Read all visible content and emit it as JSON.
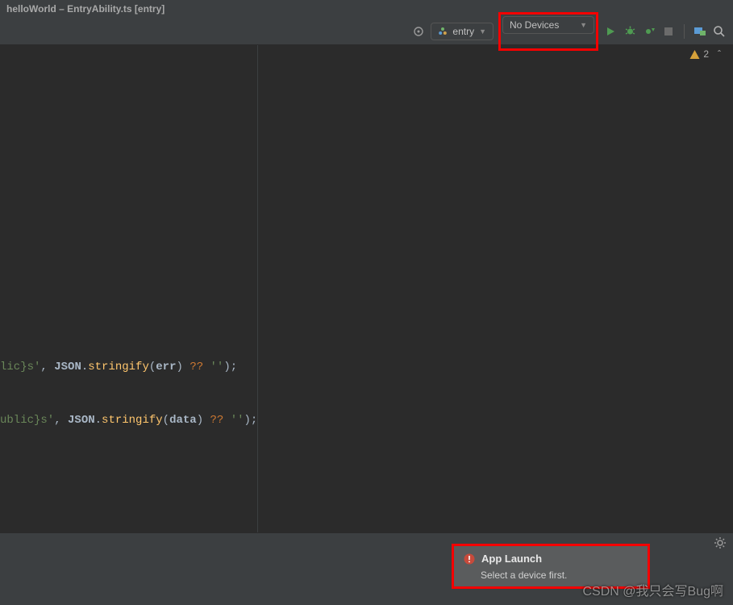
{
  "titlebar": {
    "text": "helloWorld – EntryAbility.ts [entry]"
  },
  "toolbar": {
    "module_label": "entry",
    "device_label": "No Devices"
  },
  "hints": {
    "warn_count": "2"
  },
  "code": {
    "l1_a": "lic}s'",
    "l1_b": "JSON",
    "l1_c": "stringify",
    "l1_d": "err",
    "l1_e": "??",
    "l1_f": "''",
    "l2_a": "ublic}s'",
    "l2_b": "JSON",
    "l2_c": "stringify",
    "l2_d": "data",
    "l2_e": "??",
    "l2_f": "''"
  },
  "notif": {
    "title": "App Launch",
    "body": "Select a device first."
  },
  "watermark": "CSDN @我只会写Bug啊"
}
